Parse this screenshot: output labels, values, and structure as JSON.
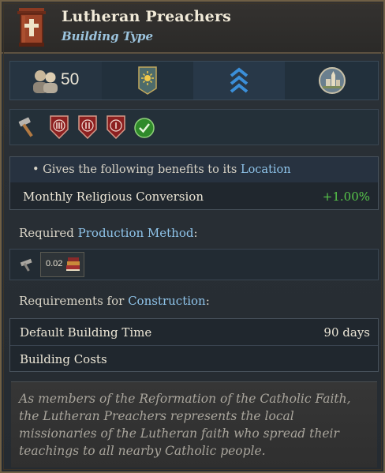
{
  "header": {
    "title": "Lutheran Preachers",
    "subtitle": "Building Type"
  },
  "stats": {
    "population": "50"
  },
  "benefits": {
    "intro_prefix": "• Gives the following benefits to its ",
    "intro_link": "Location",
    "rows": [
      {
        "label": "Monthly Religious Conversion",
        "value": "+1.00%"
      }
    ]
  },
  "production": {
    "heading_prefix": "Required ",
    "heading_link": "Production Method",
    "heading_suffix": ":",
    "input_amount": "0.02"
  },
  "requirements": {
    "heading_prefix": "Requirements for ",
    "heading_link": "Construction",
    "heading_suffix": ":",
    "rows": [
      {
        "label": "Default Building Time",
        "value": "90 days"
      },
      {
        "label": "Building Costs",
        "value": ""
      }
    ]
  },
  "description": "As members of the Reformation of the Catholic Faith, the Lutheran Preachers represents the local missionaries of the Lutheran faith who spread their teachings to all nearby Catholic people.",
  "colors": {
    "positive": "#57c64a",
    "link": "#8fc4ea",
    "title": "#f1ead8"
  },
  "icons": [
    "pulpit-cross-icon",
    "population-icon",
    "sun-banner-icon",
    "rank-chevrons-icon",
    "town-icon",
    "hammer-icon",
    "tier-iii-shield-icon",
    "tier-ii-shield-icon",
    "tier-i-shield-icon",
    "checkmark-icon",
    "production-tool-icon",
    "books-icon"
  ]
}
